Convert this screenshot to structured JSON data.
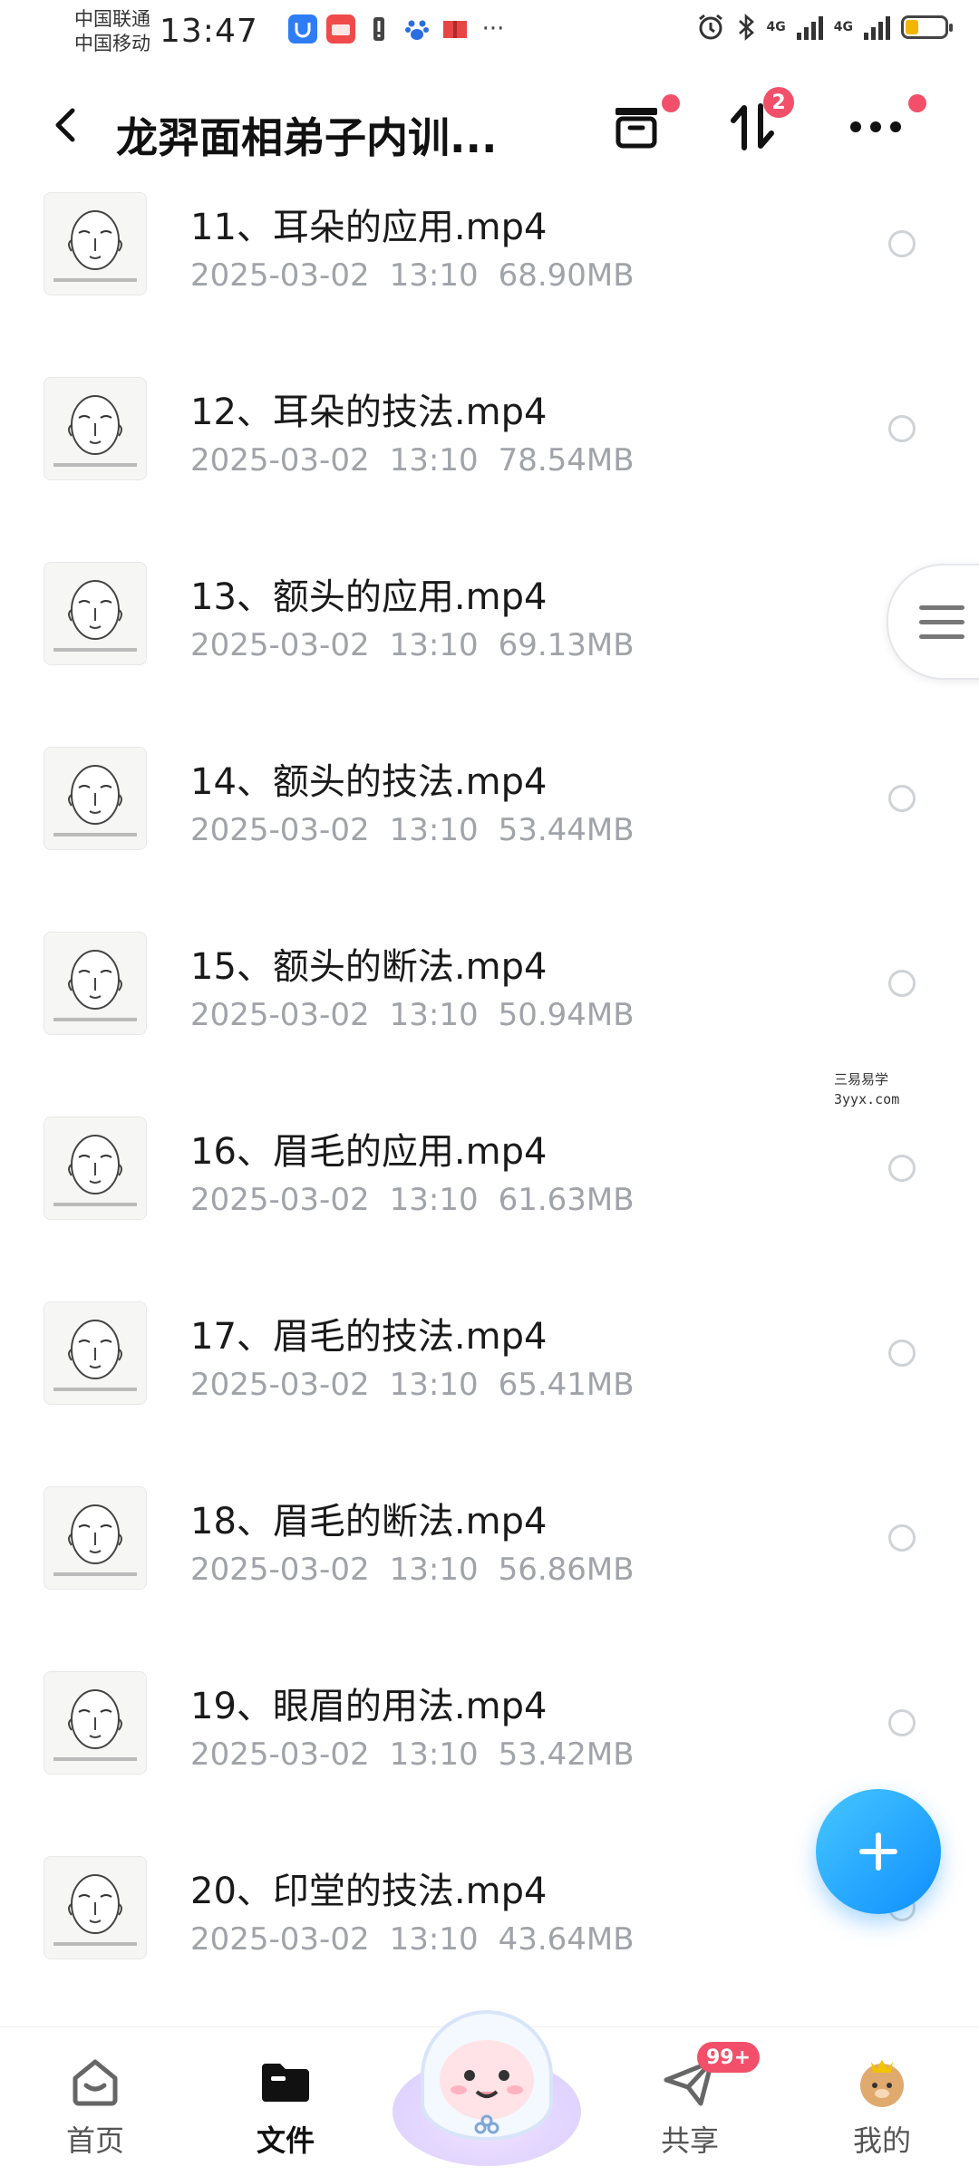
{
  "status_bar": {
    "carrier_1": "中国联通",
    "carrier_2": "中国移动",
    "time": "13:47",
    "network_1": "4G",
    "network_2": "4G"
  },
  "header": {
    "title": "龙羿面相弟子内训...",
    "transfer_badge": "2"
  },
  "files": [
    {
      "name": "11、耳朵的应用.mp4",
      "date": "2025-03-02",
      "time": "13:10",
      "size": "68.90MB"
    },
    {
      "name": "12、耳朵的技法.mp4",
      "date": "2025-03-02",
      "time": "13:10",
      "size": "78.54MB"
    },
    {
      "name": "13、额头的应用.mp4",
      "date": "2025-03-02",
      "time": "13:10",
      "size": "69.13MB"
    },
    {
      "name": "14、额头的技法.mp4",
      "date": "2025-03-02",
      "time": "13:10",
      "size": "53.44MB"
    },
    {
      "name": "15、额头的断法.mp4",
      "date": "2025-03-02",
      "time": "13:10",
      "size": "50.94MB"
    },
    {
      "name": "16、眉毛的应用.mp4",
      "date": "2025-03-02",
      "time": "13:10",
      "size": "61.63MB"
    },
    {
      "name": "17、眉毛的技法.mp4",
      "date": "2025-03-02",
      "time": "13:10",
      "size": "65.41MB"
    },
    {
      "name": "18、眉毛的断法.mp4",
      "date": "2025-03-02",
      "time": "13:10",
      "size": "56.86MB"
    },
    {
      "name": "19、眼眉的用法.mp4",
      "date": "2025-03-02",
      "time": "13:10",
      "size": "53.42MB"
    },
    {
      "name": "20、印堂的技法.mp4",
      "date": "2025-03-02",
      "time": "13:10",
      "size": "43.64MB"
    }
  ],
  "watermark": {
    "line1": "三易易学",
    "line2": "3yyx.com"
  },
  "bottom_nav": {
    "home": "首页",
    "files": "文件",
    "share": "共享",
    "share_badge": "99+",
    "mine": "我的"
  },
  "colors": {
    "accent": "#0f8fff",
    "badge": "#f2506a",
    "meta_text": "#a0a3a8"
  }
}
